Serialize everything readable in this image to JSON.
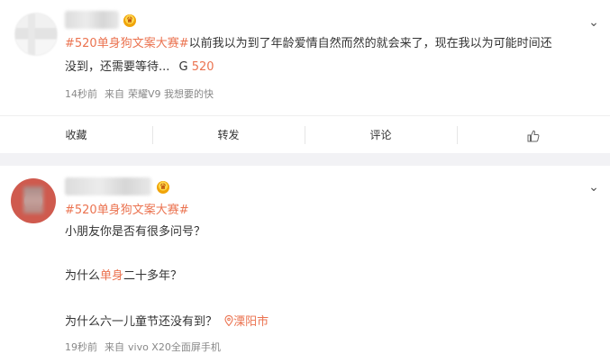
{
  "post1": {
    "tag": "#520单身狗文案大赛#",
    "line1_rest": "以前我以为到了年龄爱情自然而然的就会来了，现在我以为可能时间还",
    "line2": "没到，还需要等待...",
    "g": "G",
    "num": "520",
    "time": "14秒前",
    "source_prefix": "来自",
    "source": "荣耀V9 我想要的快",
    "actions": {
      "collect": "收藏",
      "repost": "转发",
      "comment": "评论"
    }
  },
  "post2": {
    "tag": "#520单身狗文案大赛#",
    "line1": "小朋友你是否有很多问号？",
    "line2_pre": "为什么",
    "line2_hl": "单身",
    "line2_post": "二十多年？",
    "line3": "为什么六一儿童节还没有到？",
    "location": "溧阳市",
    "time": "19秒前",
    "source_prefix": "来自",
    "source": "vivo X20全面屏手机"
  }
}
